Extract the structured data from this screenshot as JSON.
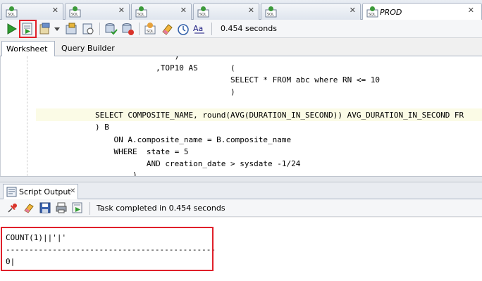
{
  "doc_tabs": [
    {
      "label": "",
      "icon": "sql-worksheet-icon",
      "closable": true
    },
    {
      "label": "",
      "icon": "sql-worksheet-icon",
      "closable": true
    },
    {
      "label": "",
      "icon": "sql-worksheet-icon",
      "closable": true
    },
    {
      "label": "",
      "icon": "sql-worksheet-icon",
      "closable": true
    },
    {
      "label": "PROD",
      "icon": "sql-worksheet-icon",
      "closable": true,
      "active": true
    }
  ],
  "toolbar": {
    "elapsed": "0.454 seconds",
    "highlight_color": "#e0202a"
  },
  "subtabs": {
    "worksheet": "Worksheet",
    "query_builder": "Query Builder"
  },
  "editor": {
    "lines": [
      {
        "text": "                 )"
      },
      {
        "text": "             ,TOP10 AS       ("
      },
      {
        "text": "                             SELECT * FROM abc where RN <= 10"
      },
      {
        "text": "                             )"
      },
      {
        "text": ""
      },
      {
        "text": "SELECT COMPOSITE_NAME, round(AVG(DURATION_IN_SECOND)) AVG_DURATION_IN_SECOND FR"
      },
      {
        "text": ") B"
      },
      {
        "text": "    ON A.composite_name = B.composite_name"
      },
      {
        "text": "    WHERE  state = 5"
      },
      {
        "text": "           AND creation_date > sysdate -1/24"
      },
      {
        "text": "        )"
      }
    ]
  },
  "output": {
    "tab_label": "Script Output",
    "status": "Task completed in 0.454 seconds",
    "result_lines": [
      "COUNT(1)||'|'",
      "---------------------------------------------",
      "0|"
    ]
  }
}
